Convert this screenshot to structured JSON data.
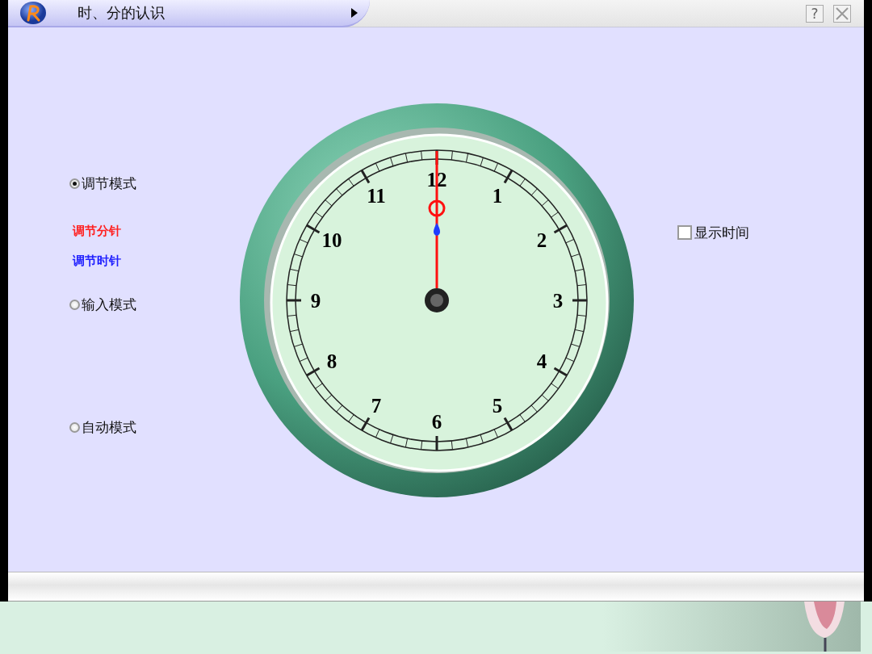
{
  "window": {
    "title": "时、分的认识",
    "help_button": "?"
  },
  "left_panel": [
    {
      "kind": "radio",
      "label": "调节模式",
      "selected": true
    },
    {
      "kind": "link",
      "label": "调节分针",
      "color": "#ff2020"
    },
    {
      "kind": "link",
      "label": "调节时针",
      "color": "#2020ff"
    },
    {
      "kind": "radio",
      "label": "输入模式",
      "selected": false
    },
    {
      "kind": "radio",
      "label": "自动模式",
      "selected": false
    }
  ],
  "clock": {
    "numerals": [
      "12",
      "1",
      "2",
      "3",
      "4",
      "5",
      "6",
      "7",
      "8",
      "9",
      "10",
      "11"
    ]
  },
  "show_time": {
    "label": "显示时间",
    "checked": false
  }
}
